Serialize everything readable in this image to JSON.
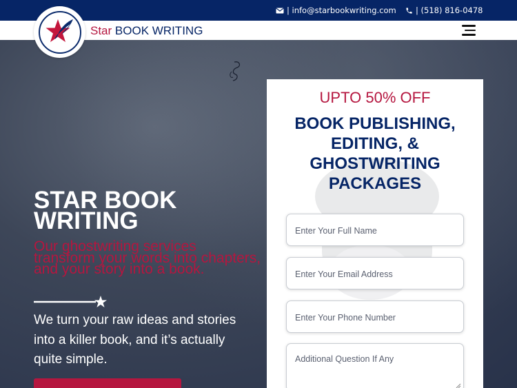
{
  "topbar": {
    "email": "| info@starbookwriting.com",
    "phone": "| (518) 816-0478",
    "email_icon": "envelope-icon",
    "phone_icon": "phone-icon"
  },
  "header": {
    "brand_star": "Star",
    "brand_rest": " BOOK WRITING",
    "logo_icon": "star-quill-logo",
    "menu_icon": "hamburger-menu-icon"
  },
  "hero": {
    "title": "STAR BOOK WRITING",
    "subtitle": "Our ghostwriting services transform your words into chapters, and your story into a book.",
    "body": "We turn your raw ideas and stories into a killer book, and it’s actually quite simple."
  },
  "form": {
    "offer": "UPTO 50% OFF",
    "title": "BOOK PUBLISHING, EDITING, & GHOSTWRITING PACKAGES",
    "name_placeholder": "Enter Your Full Name",
    "email_placeholder": "Enter Your Email Address",
    "phone_placeholder": "Enter Your Phone Number",
    "question_placeholder": "Additional Question If Any"
  },
  "colors": {
    "navy": "#062566",
    "crimson": "#b5163f",
    "white": "#ffffff"
  }
}
